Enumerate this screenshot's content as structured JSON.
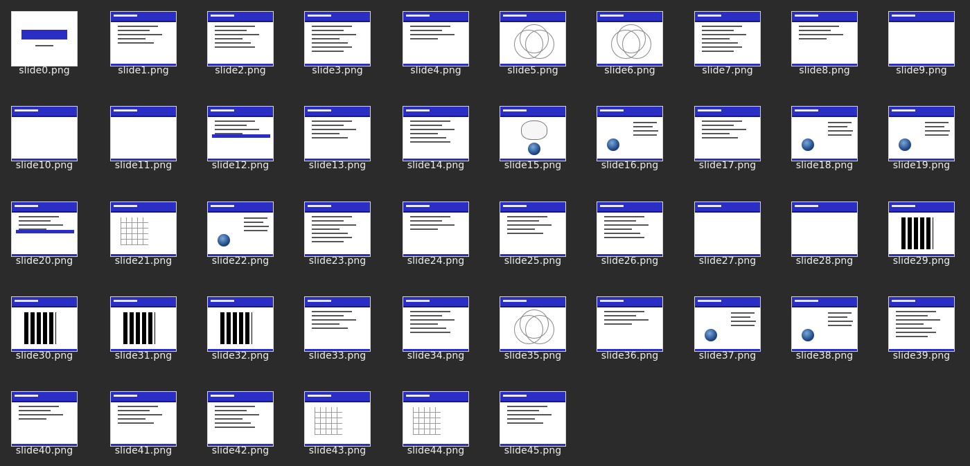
{
  "files": [
    "slide0.png",
    "slide1.png",
    "slide2.png",
    "slide3.png",
    "slide4.png",
    "slide5.png",
    "slide6.png",
    "slide7.png",
    "slide8.png",
    "slide9.png",
    "slide10.png",
    "slide11.png",
    "slide12.png",
    "slide13.png",
    "slide14.png",
    "slide15.png",
    "slide16.png",
    "slide17.png",
    "slide18.png",
    "slide19.png",
    "slide20.png",
    "slide21.png",
    "slide22.png",
    "slide23.png",
    "slide24.png",
    "slide25.png",
    "slide26.png",
    "slide27.png",
    "slide28.png",
    "slide29.png",
    "slide30.png",
    "slide31.png",
    "slide32.png",
    "slide33.png",
    "slide34.png",
    "slide35.png",
    "slide36.png",
    "slide37.png",
    "slide38.png",
    "slide39.png",
    "slide40.png",
    "slide41.png",
    "slide42.png",
    "slide43.png",
    "slide44.png",
    "slide45.png"
  ],
  "colors": {
    "background": "#2b2b2b",
    "label": "#ececec",
    "slide_header": "#2b2ec4",
    "thumb_border": "#d8d8d8"
  }
}
